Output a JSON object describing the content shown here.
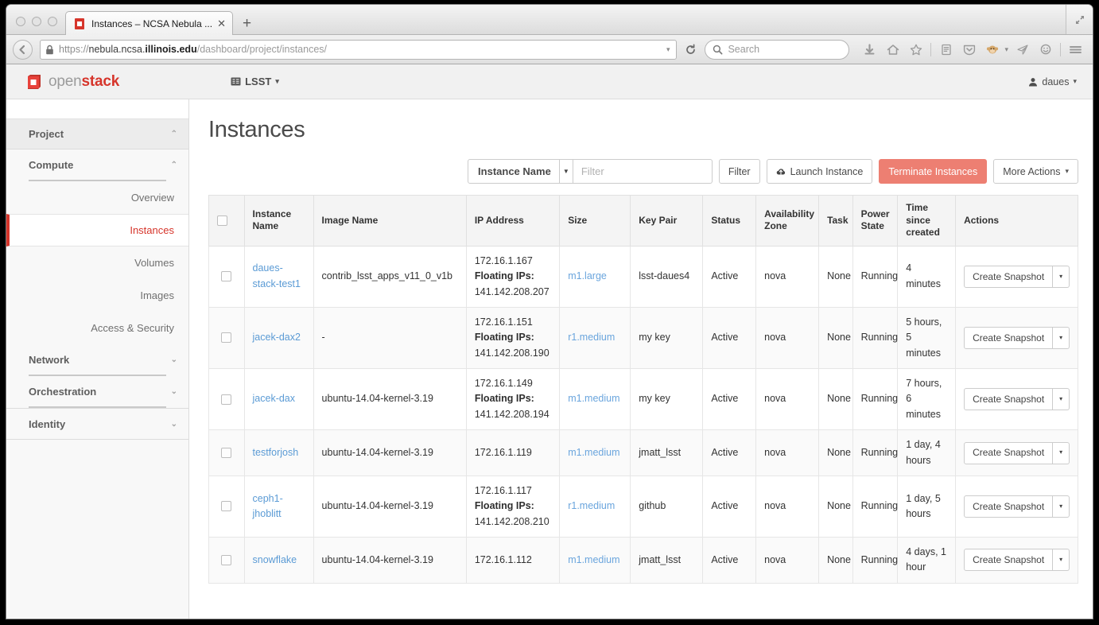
{
  "browser": {
    "tab_title": "Instances – NCSA Nebula ...",
    "tab_close_label": "✕",
    "new_tab_label": "+",
    "url_scheme": "https://",
    "url_subdomain": "nebula.ncsa.",
    "url_domain": "illinois.edu",
    "url_path": "/dashboard/project/instances/",
    "search_placeholder": "Search",
    "icons": {
      "lock": "lock-icon",
      "back": "back-icon",
      "reload": "reload-icon",
      "dropmarker": "chevron-down-icon",
      "search": "search-icon",
      "downloads": "download-arrow-icon",
      "home": "home-icon",
      "bookmark": "star-icon",
      "reader": "reading-list-icon",
      "pocket": "pocket-shield-icon",
      "persona": "monkey-avatar-icon",
      "share": "paper-plane-icon",
      "chat": "chat-bubble-icon",
      "menu": "hamburger-menu-icon",
      "restore": "restore-window-icon"
    }
  },
  "topnav": {
    "logo_open": "open",
    "logo_stack": "stack",
    "project": "LSST",
    "user": "daues"
  },
  "sidebar": {
    "groups": [
      {
        "label": "Project",
        "chevron": "⌃"
      },
      {
        "label": "Compute",
        "chevron": "⌃"
      }
    ],
    "compute_links": [
      {
        "label": "Overview",
        "active": false
      },
      {
        "label": "Instances",
        "active": true
      },
      {
        "label": "Volumes",
        "active": false
      },
      {
        "label": "Images",
        "active": false
      },
      {
        "label": "Access & Security",
        "active": false
      }
    ],
    "network": {
      "label": "Network",
      "chevron": "⌄"
    },
    "orchestration": {
      "label": "Orchestration",
      "chevron": "⌄"
    },
    "identity": {
      "label": "Identity",
      "chevron": "⌄"
    }
  },
  "main": {
    "title": "Instances",
    "toolbar": {
      "filter_field": "Instance Name",
      "filter_placeholder": "Filter",
      "filter_button": "Filter",
      "launch_button": "Launch Instance",
      "terminate_button": "Terminate Instances",
      "more_actions_button": "More Actions",
      "more_actions_caret": "▾"
    },
    "table": {
      "columns": [
        "Instance Name",
        "Image Name",
        "IP Address",
        "Size",
        "Key Pair",
        "Status",
        "Availability Zone",
        "Task",
        "Power State",
        "Time since created",
        "Actions"
      ],
      "floating_label": "Floating IPs:",
      "snapshot_label": "Create Snapshot",
      "snapshot_caret": "▾",
      "rows": [
        {
          "name": "daues-stack-test1",
          "image": "contrib_lsst_apps_v11_0_v1b",
          "ip": "172.16.1.167",
          "floating_ip": "141.142.208.207",
          "size": "m1.large",
          "keypair": "lsst-daues4",
          "status": "Active",
          "zone": "nova",
          "task": "None",
          "power": "Running",
          "time": "4 minutes"
        },
        {
          "name": "jacek-dax2",
          "image": "-",
          "ip": "172.16.1.151",
          "floating_ip": "141.142.208.190",
          "size": "r1.medium",
          "keypair": "my key",
          "status": "Active",
          "zone": "nova",
          "task": "None",
          "power": "Running",
          "time": "5 hours, 5 minutes"
        },
        {
          "name": "jacek-dax",
          "image": "ubuntu-14.04-kernel-3.19",
          "ip": "172.16.1.149",
          "floating_ip": "141.142.208.194",
          "size": "m1.medium",
          "keypair": "my key",
          "status": "Active",
          "zone": "nova",
          "task": "None",
          "power": "Running",
          "time": "7 hours, 6 minutes"
        },
        {
          "name": "testforjosh",
          "image": "ubuntu-14.04-kernel-3.19",
          "ip": "172.16.1.119",
          "floating_ip": "",
          "size": "m1.medium",
          "keypair": "jmatt_lsst",
          "status": "Active",
          "zone": "nova",
          "task": "None",
          "power": "Running",
          "time": "1 day, 4 hours"
        },
        {
          "name": "ceph1-jhoblitt",
          "image": "ubuntu-14.04-kernel-3.19",
          "ip": "172.16.1.117",
          "floating_ip": "141.142.208.210",
          "size": "r1.medium",
          "keypair": "github",
          "status": "Active",
          "zone": "nova",
          "task": "None",
          "power": "Running",
          "time": "1 day, 5 hours"
        },
        {
          "name": "snowflake",
          "image": "ubuntu-14.04-kernel-3.19",
          "ip": "172.16.1.112",
          "floating_ip": "",
          "size": "m1.medium",
          "keypair": "jmatt_lsst",
          "status": "Active",
          "zone": "nova",
          "task": "None",
          "power": "Running",
          "time": "4 days, 1 hour"
        }
      ]
    }
  },
  "colors": {
    "accent_red": "#d6352b",
    "danger_button": "#ed7f72",
    "link_blue": "#5b9bd5"
  }
}
